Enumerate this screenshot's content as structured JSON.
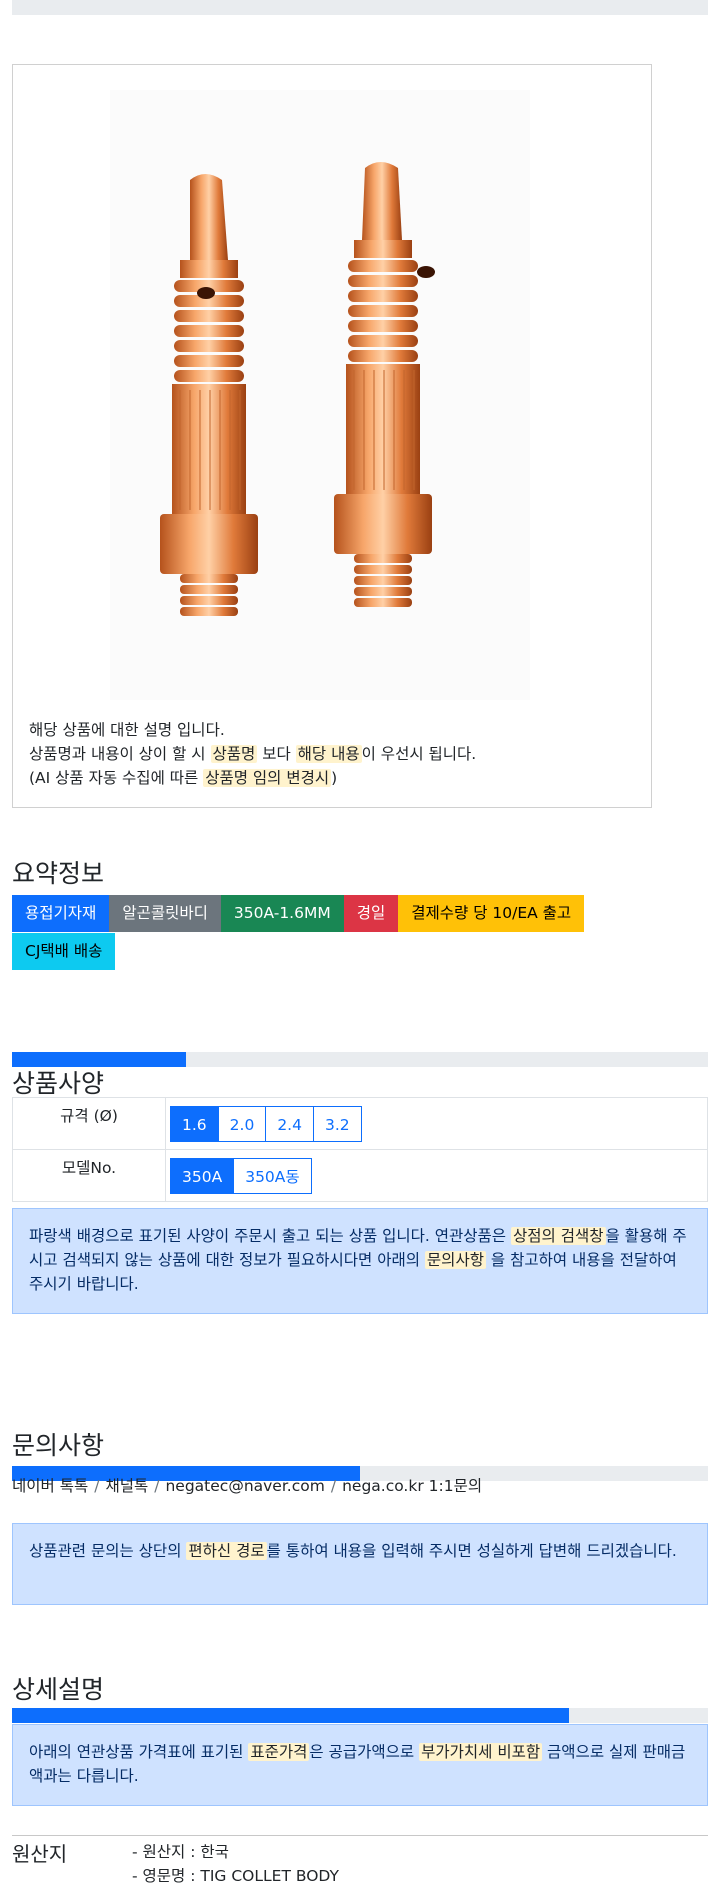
{
  "product_image": {
    "alt": "TIG COLLET BODY",
    "description_lines": {
      "line1": "해당 상품에 대한 설명 입니다.",
      "line2_a": "상품명과 내용이 상이 할 시 ",
      "line2_mark1": "상품명",
      "line2_b": " 보다 ",
      "line2_mark2": "해당 내용",
      "line2_c": "이 우선시 됩니다.",
      "line3_a": "(AI 상품 자동 수집에 따른 ",
      "line3_mark": "상품명 임의 변경시",
      "line3_b": ")"
    }
  },
  "summary": {
    "title": "요약정보",
    "badges": [
      {
        "label": "용접기자재",
        "color": "#0d6efd",
        "text_color": "#ffffff"
      },
      {
        "label": "알곤콜릿바디",
        "color": "#6c757d",
        "text_color": "#ffffff"
      },
      {
        "label": "350A-1.6MM",
        "color": "#198754",
        "text_color": "#ffffff"
      },
      {
        "label": "경일",
        "color": "#dc3545",
        "text_color": "#ffffff"
      },
      {
        "label": "결제수량 당 10/EA 출고",
        "color": "#ffc107",
        "text_color": "#000000"
      },
      {
        "label": "CJ택배 배송",
        "color": "#0dcaf0",
        "text_color": "#000000"
      }
    ]
  },
  "spec": {
    "progress": 0.25,
    "title": "상품사양",
    "rows": [
      {
        "label": "규격 (Ø)",
        "options": [
          "1.6",
          "2.0",
          "2.4",
          "3.2"
        ],
        "selected": 0
      },
      {
        "label": "모델No.",
        "options": [
          "350A",
          "350A동"
        ],
        "selected": 0
      }
    ],
    "notice": {
      "a": "파랑색 배경으로 표기된 사양이 주문시 출고 되는 상품 입니다. 연관상품은 ",
      "mark1": "상점의 검색창",
      "b": "을 활용해 주시고 검색되지 않는 상품에 대한 정보가 필요하시다면 아래의 ",
      "mark2": "문의사항",
      "c": " 을 참고하여 내용을 전달하여 주시기 바랍니다."
    }
  },
  "inquiry": {
    "title": "문의사항",
    "progress": 0.5,
    "contacts": [
      "네이버 톡톡",
      "채널톡",
      "negatec@naver.com",
      "nega.co.kr 1:1문의"
    ],
    "separator": "/",
    "notice": {
      "a": "상품관련 문의는 상단의 ",
      "mark": "편하신 경로",
      "b": "를 통하여 내용을 입력해 주시면 성실하게 답변해 드리겠습니다."
    }
  },
  "detail": {
    "title": "상세설명",
    "progress": 0.8,
    "notice": {
      "a": "아래의 연관상품 가격표에 표기된 ",
      "mark1": "표준가격",
      "b": "은 공급가액으로 ",
      "mark2": "부가가치세 비포함",
      "c": " 금액으로 실제 판매금액과는 다릅니다."
    }
  },
  "origin": {
    "label": "원산지",
    "items": [
      "- 원산지 : 한국",
      "- 영문명 : TIG COLLET BODY"
    ]
  }
}
